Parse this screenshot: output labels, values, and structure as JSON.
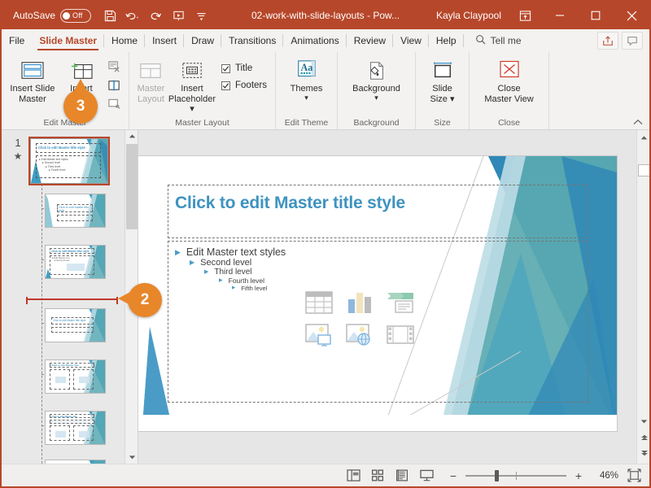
{
  "titlebar": {
    "autosave_label": "AutoSave",
    "autosave_state": "Off",
    "document_title": "02-work-with-slide-layouts  -  Pow...",
    "account_name": "Kayla Claypool",
    "qat": [
      {
        "name": "save-icon",
        "label": "Save"
      },
      {
        "name": "undo-icon",
        "label": "Undo"
      },
      {
        "name": "redo-icon",
        "label": "Redo"
      },
      {
        "name": "start-from-beginning-icon",
        "label": "Start From Beginning"
      },
      {
        "name": "customize-qat-icon",
        "label": "Customize Quick Access Toolbar"
      }
    ],
    "window_buttons": [
      "minimize",
      "maximize",
      "close"
    ],
    "ribbon_display_label": "Ribbon Display Options",
    "brand_color": "#B7472A"
  },
  "tabs": [
    {
      "label": "File",
      "active": false
    },
    {
      "label": "Slide Master",
      "active": true
    },
    {
      "label": "Home",
      "active": false
    },
    {
      "label": "Insert",
      "active": false
    },
    {
      "label": "Draw",
      "active": false
    },
    {
      "label": "Transitions",
      "active": false
    },
    {
      "label": "Animations",
      "active": false
    },
    {
      "label": "Review",
      "active": false
    },
    {
      "label": "View",
      "active": false
    },
    {
      "label": "Help",
      "active": false
    }
  ],
  "tellme": {
    "label": "Tell me",
    "icon": "search-icon"
  },
  "tabstrip_right": [
    {
      "name": "share-button",
      "label": "Share"
    },
    {
      "name": "comments-button",
      "label": "Comments"
    }
  ],
  "ribbon": {
    "groups": [
      {
        "title": "Edit Master",
        "buttons": [
          {
            "name": "insert-slide-master-button",
            "line1": "Insert Slide",
            "line2": "Master",
            "disabled": false
          },
          {
            "name": "insert-layout-button",
            "line1": "Insert",
            "line2": "Layout",
            "disabled": false
          }
        ],
        "small_buttons": [
          {
            "name": "delete-master-button",
            "label": "Delete"
          },
          {
            "name": "rename-master-button",
            "label": "Rename"
          },
          {
            "name": "preserve-master-button",
            "label": "Preserve"
          }
        ]
      },
      {
        "title": "Master Layout",
        "buttons": [
          {
            "name": "master-layout-button",
            "line1": "Master",
            "line2": "Layout",
            "disabled": true
          },
          {
            "name": "insert-placeholder-button",
            "line1": "Insert",
            "line2": "Placeholder ▾",
            "disabled": false
          }
        ],
        "checkboxes": [
          {
            "name": "title-checkbox",
            "label": "Title",
            "checked": true
          },
          {
            "name": "footers-checkbox",
            "label": "Footers",
            "checked": true
          }
        ]
      },
      {
        "title": "Edit Theme",
        "buttons": [
          {
            "name": "themes-button",
            "line1": "Themes",
            "line2": "▾",
            "disabled": false
          }
        ]
      },
      {
        "title": "Background",
        "buttons": [
          {
            "name": "background-styles-button",
            "line1": "Background",
            "line2": "▾",
            "disabled": false
          }
        ]
      },
      {
        "title": "Size",
        "buttons": [
          {
            "name": "slide-size-button",
            "line1": "Slide",
            "line2": "Size ▾",
            "disabled": false
          }
        ]
      },
      {
        "title": "Close",
        "buttons": [
          {
            "name": "close-master-view-button",
            "line1": "Close",
            "line2": "Master View",
            "disabled": false
          }
        ]
      }
    ],
    "collapse_label": "Collapse the Ribbon"
  },
  "thumbnails": {
    "master_number": "1",
    "preserve_marker": "★",
    "items": [
      {
        "name": "slide-master-thumbnail",
        "type": "master",
        "selected": true,
        "layout": "title-and-content"
      },
      {
        "name": "title-slide-layout-thumbnail",
        "type": "layout",
        "selected": false,
        "layout": "title-slide"
      },
      {
        "name": "title-and-content-layout-thumbnail",
        "type": "layout",
        "selected": false,
        "layout": "title-content"
      },
      {
        "name": "section-header-layout-thumbnail",
        "type": "layout",
        "selected": false,
        "layout": "section-header"
      },
      {
        "name": "two-content-layout-thumbnail",
        "type": "layout",
        "selected": false,
        "layout": "two-content"
      },
      {
        "name": "comparison-layout-thumbnail",
        "type": "layout",
        "selected": false,
        "layout": "comparison"
      },
      {
        "name": "title-only-layout-thumbnail",
        "type": "layout",
        "selected": false,
        "layout": "title-only"
      }
    ],
    "insert_position_marker": true
  },
  "slide": {
    "title_placeholder": "Click to edit Master title style",
    "body_levels": [
      {
        "text": "Edit Master text styles",
        "level": 1
      },
      {
        "text": "Second level",
        "level": 2
      },
      {
        "text": "Third level",
        "level": 3
      },
      {
        "text": "Fourth level",
        "level": 4
      },
      {
        "text": "Fifth level",
        "level": 5
      }
    ],
    "content_icons": [
      {
        "name": "insert-table-icon",
        "label": "Insert Table"
      },
      {
        "name": "insert-chart-icon",
        "label": "Insert Chart"
      },
      {
        "name": "insert-smartart-icon",
        "label": "Insert SmartArt Graphic"
      },
      {
        "name": "insert-picture-icon",
        "label": "Pictures"
      },
      {
        "name": "insert-online-picture-icon",
        "label": "Online Pictures"
      },
      {
        "name": "insert-video-icon",
        "label": "Insert Video"
      }
    ],
    "theme_colors": {
      "title_text": "#3e93c0",
      "accent_dark": "#2f88b7",
      "accent_mid": "#4aa5bd",
      "accent_teal": "#5aa9b0",
      "accent_light": "#bcdde6"
    }
  },
  "statusbar": {
    "view_buttons": [
      {
        "name": "normal-view-button",
        "label": "Normal"
      },
      {
        "name": "slide-sorter-view-button",
        "label": "Slide Sorter"
      },
      {
        "name": "reading-view-button",
        "label": "Reading View"
      },
      {
        "name": "slide-show-button",
        "label": "Slide Show"
      }
    ],
    "zoom_out_label": "−",
    "zoom_in_label": "+",
    "zoom_percent": "46%",
    "fit_label": "Fit slide to current window"
  },
  "callouts": [
    {
      "name": "callout-badge-3",
      "number": "3",
      "direction": "up"
    },
    {
      "name": "callout-badge-2",
      "number": "2",
      "direction": "left"
    }
  ]
}
